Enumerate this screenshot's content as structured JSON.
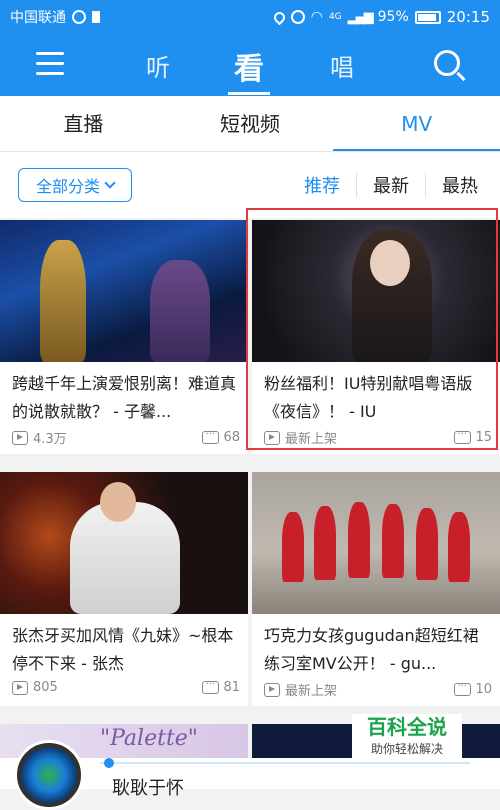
{
  "status_bar": {
    "carrier": "中国联通",
    "network": "4G",
    "battery": "95%",
    "time": "20:15"
  },
  "top_nav": {
    "tabs": [
      "听",
      "看",
      "唱"
    ],
    "active_tab": "看"
  },
  "sub_tabs": {
    "items": [
      "直播",
      "短视频",
      "MV"
    ],
    "active": "MV"
  },
  "filter": {
    "category_button": "全部分类",
    "sort_options": [
      "推荐",
      "最新",
      "最热"
    ],
    "active_sort": "推荐"
  },
  "videos": [
    {
      "title": "跨越千年上演爱恨别离！难道真的说散就散？ - 子馨...",
      "plays": "4.3万",
      "comments": "68"
    },
    {
      "title": "粉丝福利！IU特别献唱粤语版《夜信》！ - IU",
      "plays": "最新上架",
      "comments": "15"
    },
    {
      "title": "张杰牙买加风情《九妹》~根本停不下来 - 张杰",
      "plays": "805",
      "comments": "81"
    },
    {
      "title": "巧克力女孩gugudan超短红裙练习室MV公开！ - gu...",
      "plays": "最新上架",
      "comments": "10"
    }
  ],
  "peek": {
    "palette_text": "\"Palette\""
  },
  "player": {
    "song_title": "耿耿于怀"
  },
  "watermark": {
    "line1": "百科全说",
    "line2": "助你轻松解决"
  },
  "colors": {
    "brand_blue": "#1f8ff0",
    "highlight_red": "#e03c3c"
  }
}
